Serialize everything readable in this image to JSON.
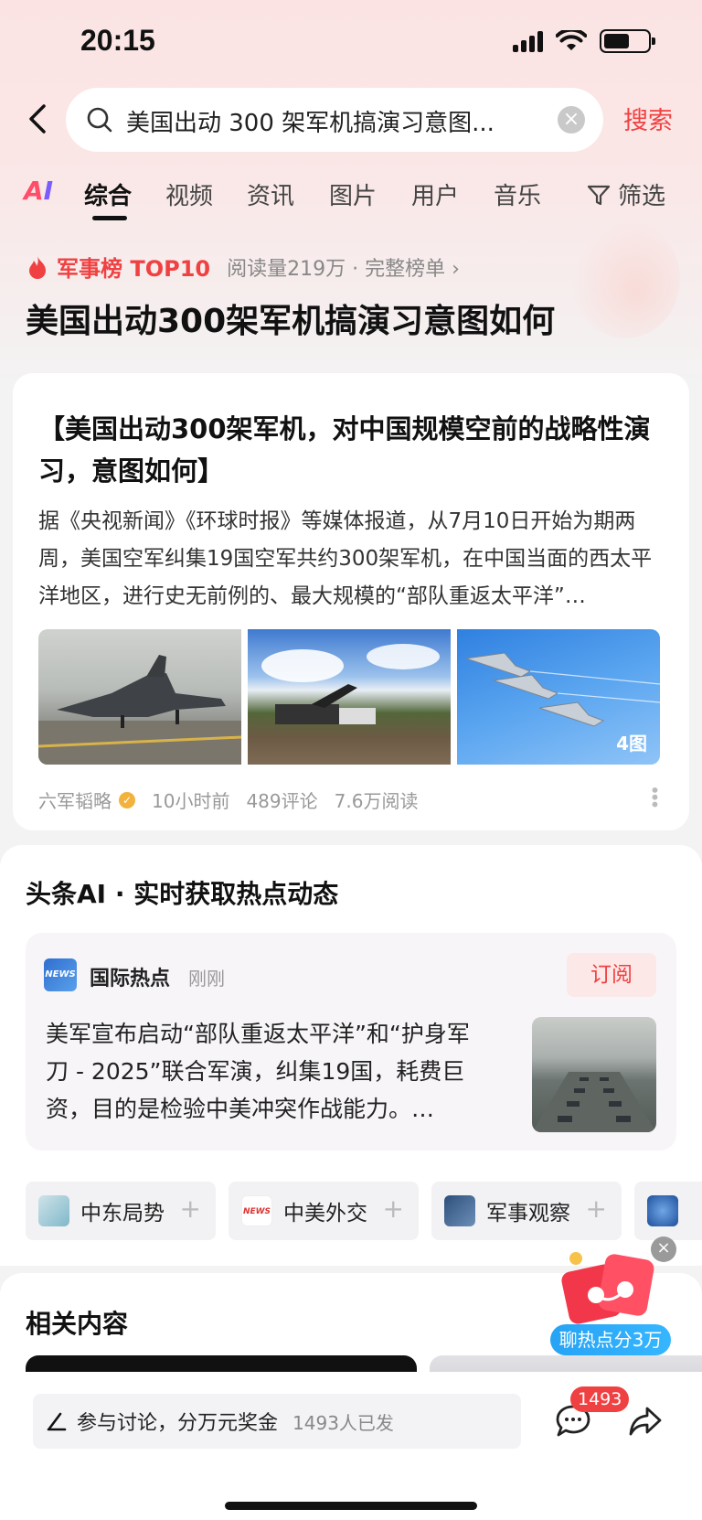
{
  "status_bar": {
    "time": "20:15"
  },
  "search": {
    "query": "美国出动 300 架军机搞演习意图...",
    "search_label": "搜索"
  },
  "tabs": {
    "ai_left": "A",
    "ai_right": "I",
    "items": [
      "综合",
      "视频",
      "资讯",
      "图片",
      "用户",
      "音乐"
    ],
    "filter_label": "筛选"
  },
  "ranking": {
    "label": "军事榜 TOP10",
    "meta": "阅读量219万 · 完整榜单 ›",
    "title": "美国出动300架军机搞演习意图如何"
  },
  "article": {
    "title": "【美国出动300架军机，对中国规模空前的战略性演习，意图如何】",
    "body": "据《央视新闻》《环球时报》等媒体报道，从7月10日开始为期两周，美国空军纠集19国空军共约300架军机，在中国当面的西太平洋地区，进行史无前例的、最大规模的“部队重返太平洋”…",
    "image_count": "4图",
    "author": "六军韬略",
    "time": "10小时前",
    "comments": "489评论",
    "reads": "7.6万阅读"
  },
  "ai_section": {
    "title": "头条AI · 实时获取热点动态",
    "source_logo": "NEWS",
    "source_name": "国际热点",
    "source_time": "刚刚",
    "subscribe_label": "订阅",
    "text": "美军宣布启动“部队重返太平洋”和“护身军刀 - 2025”联合军演，纠集19国，耗费巨资，目的是检验中美冲突作战能力。…",
    "topics": [
      "中东局势",
      "中美外交",
      "军事观察"
    ]
  },
  "related": {
    "title": "相关内容"
  },
  "float_widget": {
    "label": "聊热点分3万"
  },
  "bottom_bar": {
    "input_text": "参与讨论，分万元奖金",
    "input_count": "1493人已发",
    "comment_badge": "1493"
  },
  "colors": {
    "accent": "#f04142",
    "blue": "#27a3f5"
  }
}
